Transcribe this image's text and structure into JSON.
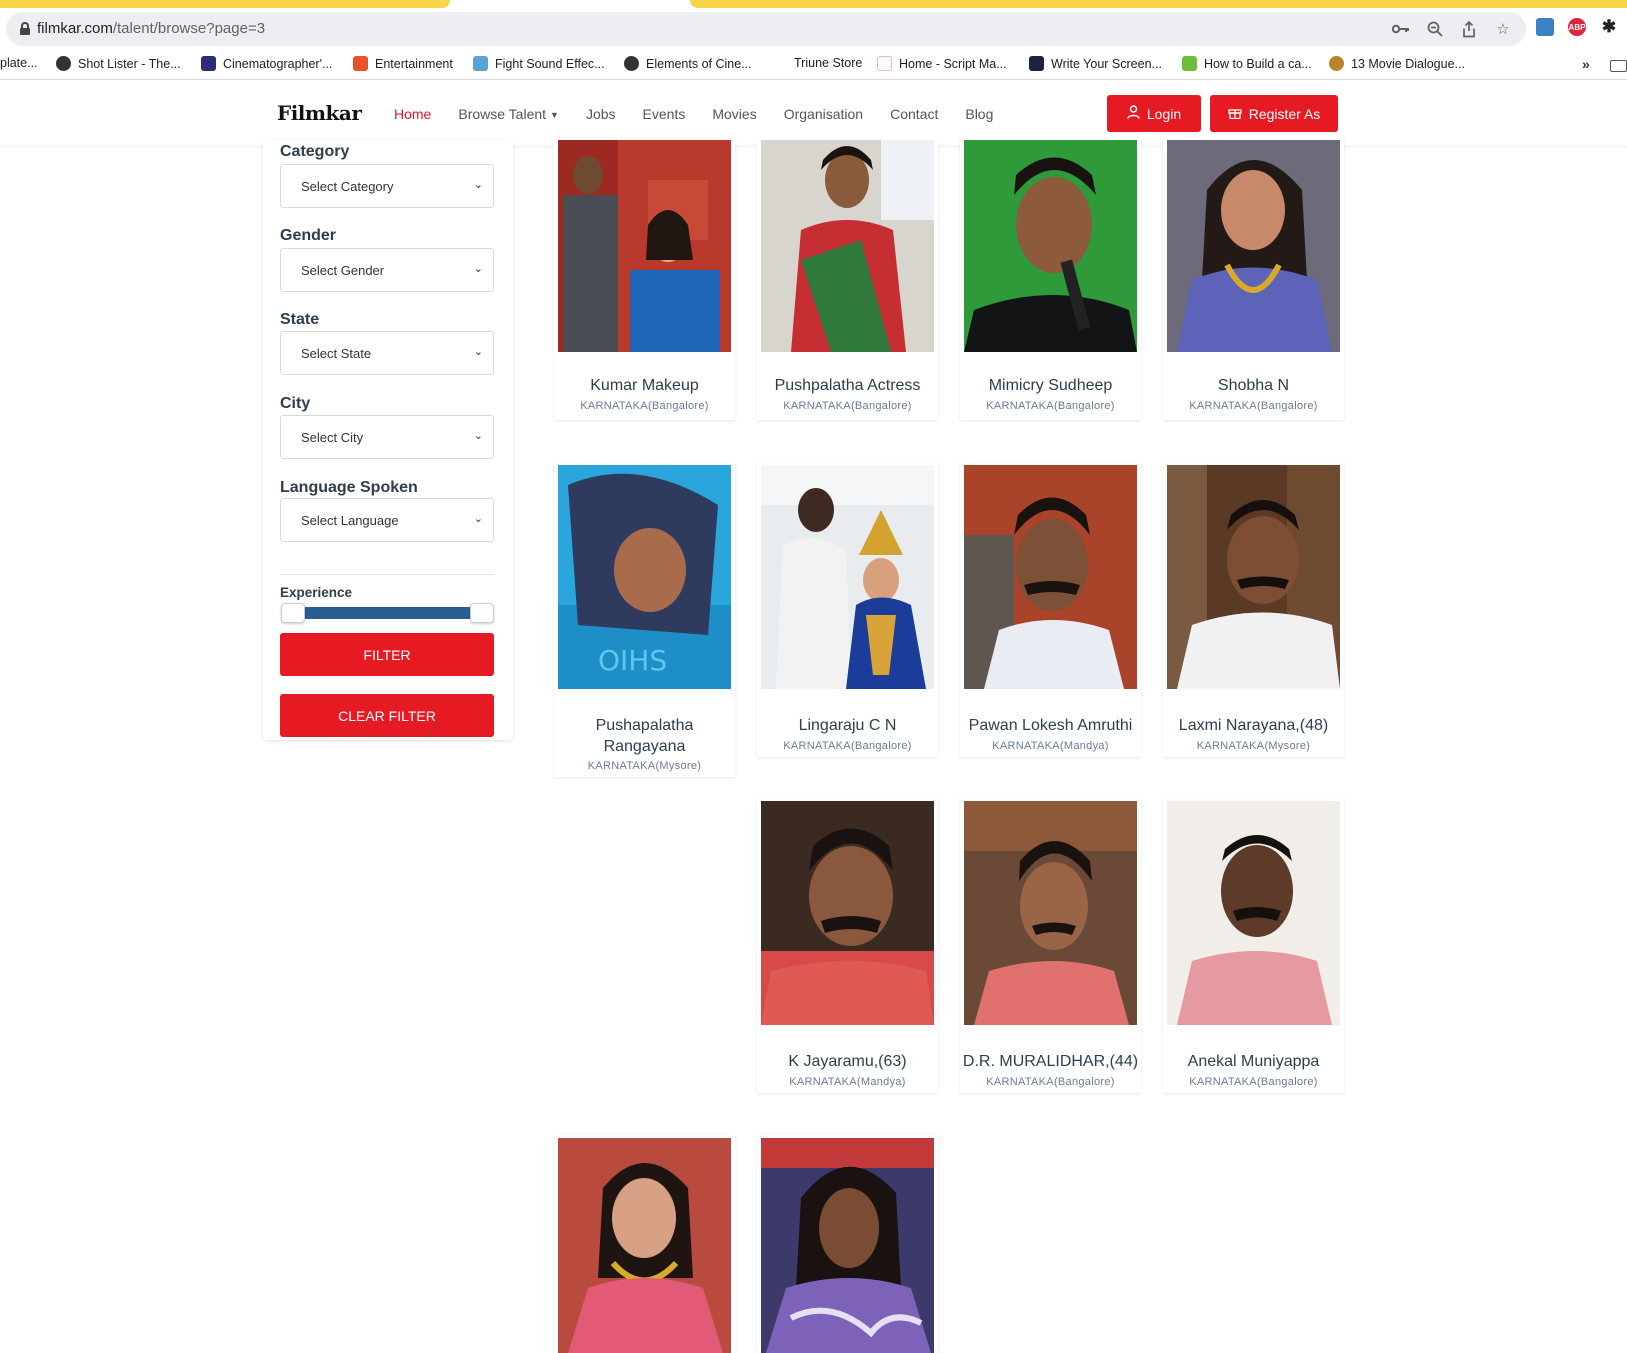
{
  "browser": {
    "url_host": "filmkar.com",
    "url_path": "/talent/browse?page=3",
    "bookmarks": [
      {
        "label": "plate..."
      },
      {
        "label": "Shot Lister - The..."
      },
      {
        "label": "Cinematographer'..."
      },
      {
        "label": "Entertainment"
      },
      {
        "label": "Fight Sound Effec..."
      },
      {
        "label": "Elements of Cine..."
      },
      {
        "label": "Triune Store"
      },
      {
        "label": "Home - Script Ma..."
      },
      {
        "label": "Write Your Screen..."
      },
      {
        "label": "How to Build a ca..."
      },
      {
        "label": "13 Movie Dialogue..."
      }
    ],
    "overflow_label": "»"
  },
  "site": {
    "logo": "Filmkar",
    "nav": [
      "Home",
      "Browse Talent",
      "Jobs",
      "Events",
      "Movies",
      "Organisation",
      "Contact",
      "Blog"
    ],
    "login_label": "Login",
    "register_label": "Register As",
    "accent_color": "#e51a23"
  },
  "filters": {
    "category": {
      "label": "Category",
      "value": "Select Category"
    },
    "gender": {
      "label": "Gender",
      "value": "Select Gender"
    },
    "state": {
      "label": "State",
      "value": "Select State"
    },
    "city": {
      "label": "City",
      "value": "Select City"
    },
    "language": {
      "label": "Language Spoken",
      "value": "Select Language"
    },
    "experience_label": "Experience",
    "experience_range": [
      0,
      1
    ],
    "filter_label": "FILTER",
    "clear_label": "CLEAR FILTER"
  },
  "talents": [
    {
      "name": "Kumar Makeup",
      "location": "KARNATAKA(Bangalore)"
    },
    {
      "name": "Pushpalatha Actress",
      "location": "KARNATAKA(Bangalore)"
    },
    {
      "name": "Mimicry Sudheep",
      "location": "KARNATAKA(Bangalore)"
    },
    {
      "name": "Shobha N",
      "location": "KARNATAKA(Bangalore)"
    },
    {
      "name": "Pushapalatha Rangayana",
      "location": "KARNATAKA(Mysore)"
    },
    {
      "name": "Lingaraju C N",
      "location": "KARNATAKA(Bangalore)"
    },
    {
      "name": "Pawan Lokesh Amruthi",
      "location": "KARNATAKA(Mandya)"
    },
    {
      "name": "Laxmi Narayana,(48)",
      "location": "KARNATAKA(Mysore)"
    },
    {
      "name": "K Jayaramu,(63)",
      "location": "KARNATAKA(Mandya)"
    },
    {
      "name": "D.R. MURALIDHAR,(44)",
      "location": "KARNATAKA(Bangalore)"
    },
    {
      "name": "Anekal Muniyappa",
      "location": "KARNATAKA(Bangalore)"
    },
    {
      "name": "",
      "location": ""
    },
    {
      "name": "",
      "location": ""
    }
  ]
}
